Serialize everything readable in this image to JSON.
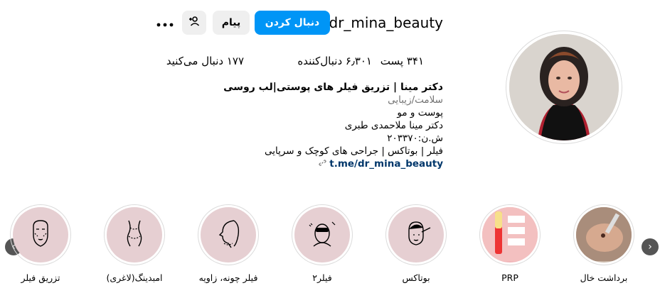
{
  "profile": {
    "username": "dr_mina_beauty",
    "follow_label": "دنبال کردن",
    "message_label": "پیام"
  },
  "stats": {
    "posts": "۳۴۱ پست",
    "followers": "۶٫۳۰۱ دنبال‌کننده",
    "following": "۱۷۷ دنبال می‌کنید"
  },
  "bio": {
    "name": "دکتر مینا | تزریق فیلر های پوستی|لب روسی",
    "category": "سلامت/زیبایی",
    "lines": [
      "پوست و مو",
      "دکتر مینا ملاحمدی طبری",
      "ش.ن:۲۰۳۳۷۰",
      "فیلر | بوتاکس | جراحی های کوچک و سرپایی"
    ],
    "link": "t.me/dr_mina_beauty"
  },
  "highlights": [
    {
      "label": "برداشت خال",
      "icon": "mole-removal-photo"
    },
    {
      "label": "PRP",
      "icon": "prp-tubes-photo"
    },
    {
      "label": "بوتاکس",
      "icon": "botox-face-icon"
    },
    {
      "label": "فیلر۲",
      "icon": "filler-face-icon"
    },
    {
      "label": "فیلر چونه، زاویه",
      "icon": "chin-profile-icon"
    },
    {
      "label": "امبدینگ(لاغری)",
      "icon": "body-silhouette-icon"
    },
    {
      "label": "تزریق فیلر",
      "icon": "face-filler-icon"
    }
  ],
  "colors": {
    "primary": "#0095f6",
    "secondary_btn": "#efefef",
    "highlight_bg": "#e6cfd2",
    "link": "#00376b",
    "muted": "#737373"
  }
}
